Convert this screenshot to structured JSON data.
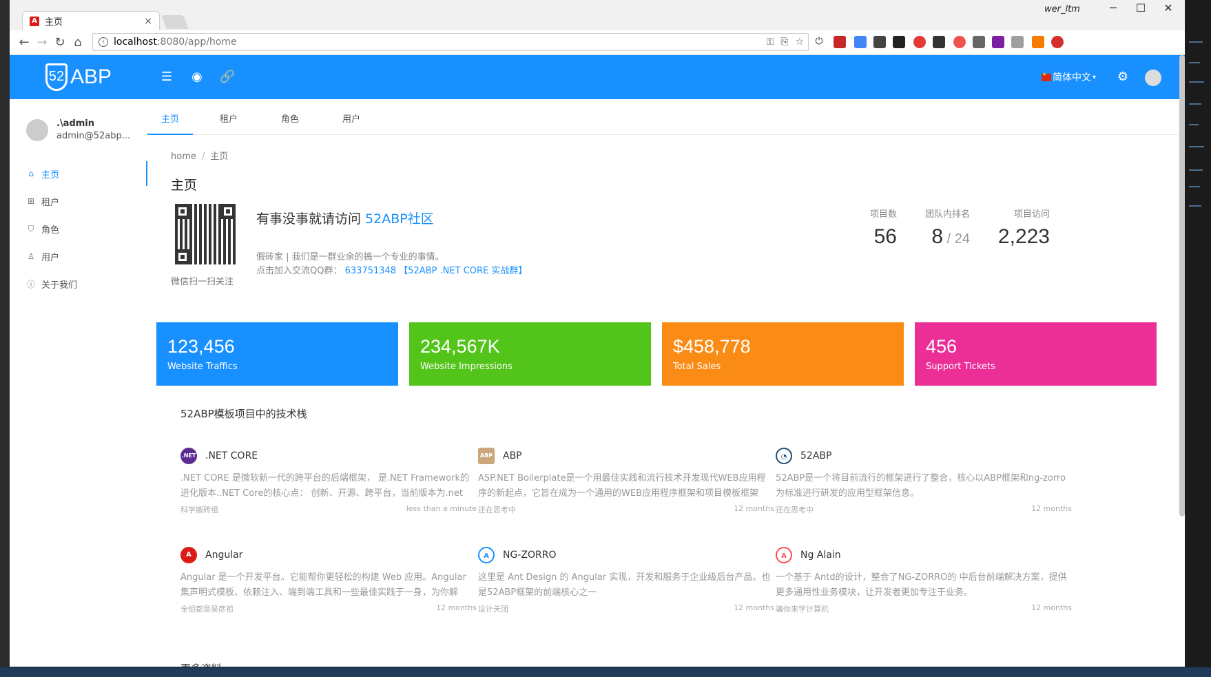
{
  "browser": {
    "tab_title": "主页",
    "tab_close": "×",
    "url_host": "localhost",
    "url_path": ":8080/app/home",
    "window_user": "wer_ltm",
    "window_controls": [
      "─",
      "☐",
      "✕"
    ]
  },
  "header": {
    "logo_text": "ABP",
    "language": "简体中文",
    "accent_color": "#1890ff"
  },
  "user": {
    "name": ".\\admin",
    "email": "admin@52abp..."
  },
  "sidebar": {
    "items": [
      {
        "label": "主页",
        "icon": "home-icon",
        "active": true
      },
      {
        "label": "租户",
        "icon": "tenants-icon",
        "active": false
      },
      {
        "label": "角色",
        "icon": "role-icon",
        "active": false
      },
      {
        "label": "用户",
        "icon": "user-icon",
        "active": false
      },
      {
        "label": "关于我们",
        "icon": "info-icon",
        "active": false
      }
    ]
  },
  "tabs": [
    "主页",
    "租户",
    "角色",
    "用户"
  ],
  "breadcrumb": {
    "home": "home",
    "sep": "/",
    "current": "主页"
  },
  "page_title": "主页",
  "intro": {
    "qr_caption": "微信扫一扫关注",
    "title_prefix": "有事没事就请访问 ",
    "title_link": "52ABP社区",
    "line1": "假砖家 | 我们是一群业余的搞一个专业的事情。",
    "line2_prefix": "点击加入交流QQ群： ",
    "line2_link": "633751348 【52ABP .NET CORE 实战群】"
  },
  "stats": [
    {
      "label": "项目数",
      "value": "56"
    },
    {
      "label": "团队内排名",
      "value": "8",
      "suffix": " / 24"
    },
    {
      "label": "项目访问",
      "value": "2,223"
    }
  ],
  "cards": [
    {
      "value": "123,456",
      "label": "Website Traffics",
      "color": "#1890ff"
    },
    {
      "value": "234,567K",
      "label": "Website Impressions",
      "color": "#52c41a"
    },
    {
      "value": "$458,778",
      "label": "Total Sales",
      "color": "#fa8c16"
    },
    {
      "value": "456",
      "label": "Support Tickets",
      "color": "#eb2f96"
    }
  ],
  "tech_section_title": "52ABP模板项目中的技术栈",
  "tech": [
    {
      "name": ".NET CORE",
      "icon": "dotnet-icon",
      "icon_text": ".NET",
      "icon_color": "#5c2d91",
      "desc": ".NET CORE 是微软新一代的跨平台的后端框架， 是.NET Framework的进化版本..NET Core的核心点： 创新、开源、跨平台，当前版本为.net",
      "author": "科学搬砖组",
      "time": "less than a minute"
    },
    {
      "name": "ABP",
      "icon": "abp-icon",
      "icon_text": "ABP",
      "icon_color": "#c9a77a",
      "desc": "ASP.NET Boilerplate是一个用最佳实践和流行技术开发现代WEB应用程序的新起点，它旨在成为一个通用的WEB应用程序框架和项目模板框架",
      "author": "还在思考中",
      "time": "12 months"
    },
    {
      "name": "52ABP",
      "icon": "52abp-icon",
      "icon_text": "◔",
      "icon_color": "#ffffff",
      "desc": "52ABP是一个将目前流行的框架进行了整合，核心以ABP框架和ng-zorro为标准进行研发的应用型框架信息。",
      "author": "还在思考中",
      "time": "12 months"
    },
    {
      "name": "Angular",
      "icon": "angular-icon",
      "icon_text": "A",
      "icon_color": "#dd1b16",
      "desc": "Angular 是一个开发平台。它能帮你更轻松的构建 Web 应用。Angular 集声明式模板、依赖注入、端到端工具和一些最佳实践于一身，为你解",
      "author": "全组都是吴彦祖",
      "time": "12 months"
    },
    {
      "name": "NG-ZORRO",
      "icon": "ng-zorro-icon",
      "icon_text": "A",
      "icon_color": "#1890ff",
      "desc": "这里是 Ant Design 的 Angular 实现，开发和服务于企业级后台产品。也是52ABP框架的前端核心之一",
      "author": "设计天团",
      "time": "12 months"
    },
    {
      "name": "Ng Alain",
      "icon": "ng-alain-icon",
      "icon_text": "A",
      "icon_color": "#ff4d4f",
      "desc": "一个基于 Antd的设计，整合了NG-ZORRO的 中后台前端解决方案，提供更多通用性业务模块，让开发者更加专注于业务。",
      "author": "骗你来学计算机",
      "time": "12 months"
    }
  ],
  "more_title": "更多资料"
}
